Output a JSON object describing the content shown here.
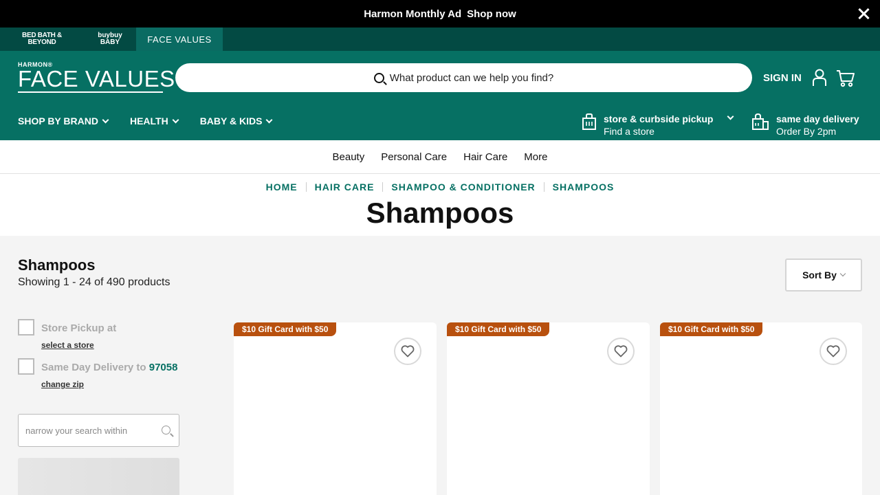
{
  "promo": {
    "text": "Harmon Monthly Ad",
    "link": "Shop now"
  },
  "brands": {
    "bbb_line1": "BED BATH &",
    "bbb_line2": "BEYOND",
    "bbaby_line1": "buybuy",
    "bbaby_line2": "BABY",
    "facevalues": "FACE VALUES"
  },
  "header": {
    "logo_small": "HARMON®",
    "logo_big": "FACE VALUES",
    "search_placeholder": "What product can we help you find?",
    "sign_in": "SIGN IN"
  },
  "category_nav": [
    {
      "label": "SHOP BY BRAND"
    },
    {
      "label": "HEALTH"
    },
    {
      "label": "BABY & KIDS"
    }
  ],
  "pickup": {
    "title": "store & curbside pickup",
    "subtitle": "Find a store"
  },
  "delivery": {
    "title": "same day delivery",
    "subtitle": "Order By 2pm"
  },
  "subnav": [
    "Beauty",
    "Personal Care",
    "Hair Care",
    "More"
  ],
  "breadcrumb": [
    "HOME",
    "HAIR CARE",
    "SHAMPOO & CONDITIONER",
    "SHAMPOOS"
  ],
  "page_title": "Shampoos",
  "results": {
    "title": "Shampoos",
    "count": "Showing 1 - 24 of 490 products",
    "sort_label": "Sort By"
  },
  "filters": {
    "store_pickup": "Store Pickup at",
    "select_store": "select a store",
    "same_day": "Same Day Delivery to",
    "zip": "97058",
    "change_zip": "change zip",
    "narrow_placeholder": "narrow your search within"
  },
  "products": [
    {
      "badge": "$10 Gift Card with $50"
    },
    {
      "badge": "$10 Gift Card with $50"
    },
    {
      "badge": "$10 Gift Card with $50"
    }
  ],
  "colors": {
    "brand_green": "#067063",
    "dark_green": "#034a43",
    "badge_orange": "#b8500e"
  }
}
